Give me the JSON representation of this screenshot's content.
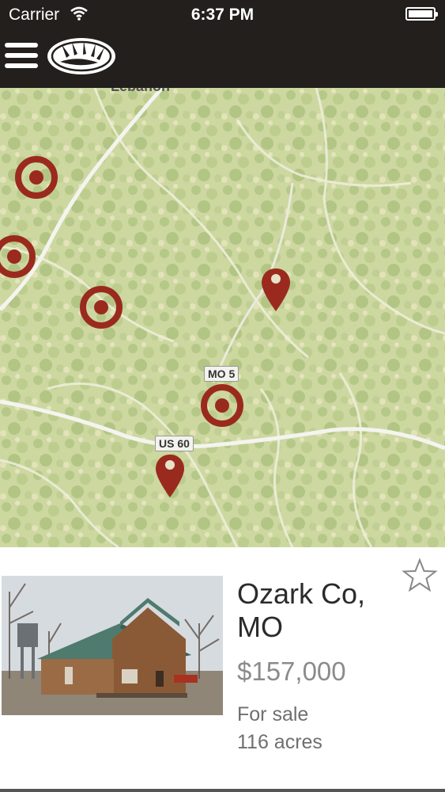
{
  "status_bar": {
    "carrier": "Carrier",
    "time": "6:37 PM"
  },
  "nav": {
    "menu_icon": "hamburger-menu-icon",
    "logo_icon": "bear-paw-logo"
  },
  "map": {
    "town_label": "Lebanon",
    "road_labels": [
      "MO 5",
      "US 60"
    ],
    "colors": {
      "marker": "#9b2a1e",
      "map_bg": "#cfd8a4"
    }
  },
  "listing": {
    "title": "Ozark Co, MO",
    "price": "$157,000",
    "status": "For sale",
    "acres": "116 acres",
    "favorite_icon": "star-outline-icon"
  }
}
